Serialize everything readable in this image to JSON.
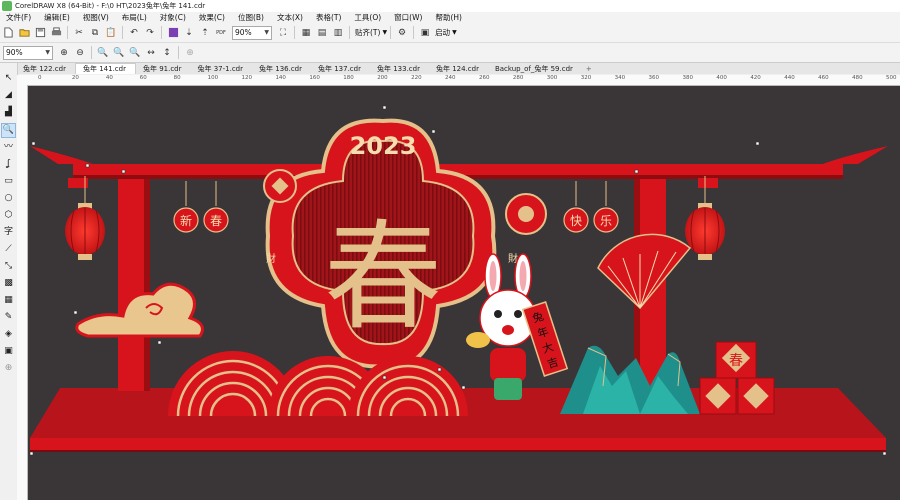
{
  "window": {
    "title": "CorelDRAW X8 (64-Bit) - F:\\0 HT\\2023兔年\\兔年 141.cdr"
  },
  "menu": [
    "文件(F)",
    "编辑(E)",
    "视图(V)",
    "布局(L)",
    "对象(C)",
    "效果(C)",
    "位图(B)",
    "文本(X)",
    "表格(T)",
    "工具(O)",
    "窗口(W)",
    "帮助(H)"
  ],
  "toolbar": {
    "zoom_value": "90%",
    "snap_label": "贴齐(T)",
    "launch_label": "启动",
    "pdf_label": "PDF"
  },
  "propertybar": {
    "zoom_value": "90%"
  },
  "tabs": [
    "兔年 122.cdr",
    "兔年 141.cdr",
    "兔年 91.cdr",
    "兔年 37-1.cdr",
    "兔年 136.cdr",
    "兔年 137.cdr",
    "兔年 133.cdr",
    "兔年 124.cdr",
    "Backup_of_兔年 59.cdr"
  ],
  "active_tab": 1,
  "ruler": {
    "h_ticks": [
      "0",
      "20",
      "40",
      "60",
      "80",
      "100",
      "120",
      "140",
      "160",
      "180",
      "200",
      "220",
      "240",
      "260",
      "280",
      "300",
      "320",
      "340",
      "360",
      "380",
      "400",
      "420",
      "440",
      "460",
      "480",
      "500"
    ]
  },
  "artwork": {
    "year": "2023",
    "big_char": "春",
    "left_chars": [
      "新",
      "春"
    ],
    "right_chars": [
      "快",
      "乐"
    ],
    "lantern_char_left": "財",
    "lantern_char_right": "財",
    "scroll_text": [
      "兔",
      "年",
      "大",
      "吉"
    ],
    "box_char": "春",
    "colors": {
      "red": "#d7141b",
      "dark_red": "#a00d12",
      "gold": "#e4c08a",
      "bg": "#3a3536",
      "teal": "#1f8f8c"
    }
  }
}
